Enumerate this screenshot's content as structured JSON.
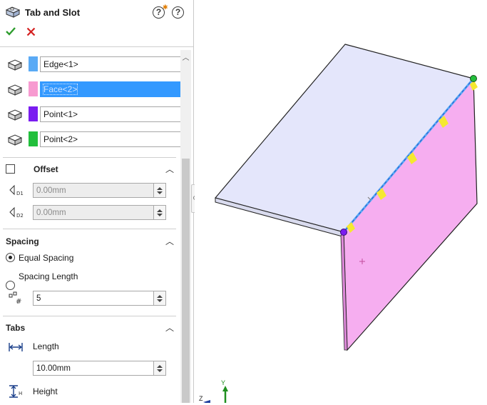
{
  "header": {
    "title": "Tab and Slot",
    "confirm_icon": "checkmark-icon",
    "cancel_icon": "close-icon"
  },
  "selections": {
    "items": [
      {
        "label": "Edge<1>",
        "color": "#5aaaf5"
      },
      {
        "label": "Face<2>",
        "color": "#f79ad0",
        "active": true
      },
      {
        "label": "Point<1>",
        "color": "#7a1cf0"
      },
      {
        "label": "Point<2>",
        "color": "#22bf3c"
      }
    ]
  },
  "offset": {
    "title": "Offset",
    "checked": false,
    "d1_value": "0.00mm",
    "d2_value": "0.00mm"
  },
  "spacing": {
    "title": "Spacing",
    "equal_label": "Equal Spacing",
    "length_label": "Spacing Length",
    "selected": "Equal Spacing",
    "count_value": "5"
  },
  "tabs": {
    "title": "Tabs",
    "length_label": "Length",
    "length_value": "10.00mm",
    "height_label": "Height"
  },
  "triad": {
    "y_label": "Y",
    "z_label": "Z"
  },
  "colors": {
    "sheet_top": "#e4e6fb",
    "sheet_side": "#f6aef0",
    "tab_marker": "#f5e830",
    "endpoint_green": "#22bf3c",
    "endpoint_purple": "#7a1cf0",
    "accent_check": "#2e9d2e",
    "accent_cancel": "#d42020"
  }
}
